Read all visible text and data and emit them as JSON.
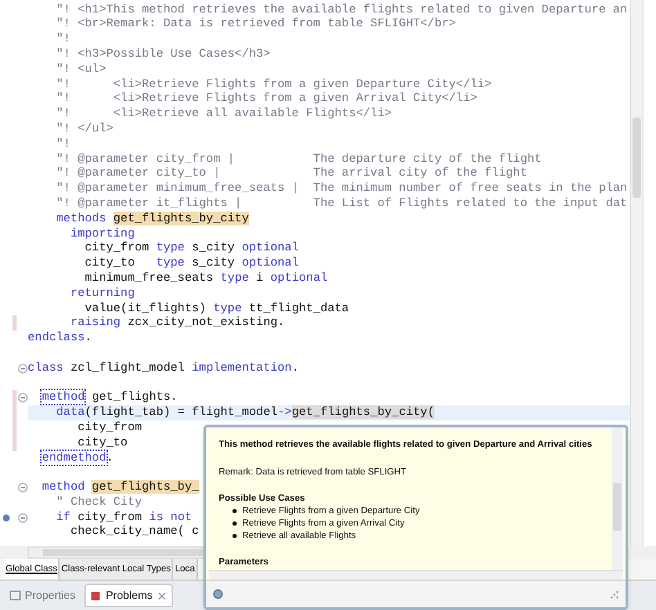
{
  "editor": {
    "lines": [
      {
        "segments": [
          {
            "kind": "comment",
            "text": "    \"! <h1>This method retrieves the available flights related to given Departure an"
          }
        ],
        "fold": false,
        "changed": false,
        "current": false,
        "bookmark": false
      },
      {
        "segments": [
          {
            "kind": "comment",
            "text": "    \"! <br>Remark: Data is retrieved from table SFLIGHT</br>"
          }
        ],
        "fold": false,
        "changed": false,
        "current": false,
        "bookmark": false
      },
      {
        "segments": [
          {
            "kind": "comment",
            "text": "    \"!"
          }
        ],
        "fold": false,
        "changed": false,
        "current": false,
        "bookmark": false
      },
      {
        "segments": [
          {
            "kind": "comment",
            "text": "    \"! <h3>Possible Use Cases</h3>"
          }
        ],
        "fold": false,
        "changed": false,
        "current": false,
        "bookmark": false
      },
      {
        "segments": [
          {
            "kind": "comment",
            "text": "    \"! <ul>"
          }
        ],
        "fold": false,
        "changed": false,
        "current": false,
        "bookmark": false
      },
      {
        "segments": [
          {
            "kind": "comment",
            "text": "    \"!      <li>Retrieve Flights from a given Departure City</li>"
          }
        ],
        "fold": false,
        "changed": false,
        "current": false,
        "bookmark": false
      },
      {
        "segments": [
          {
            "kind": "comment",
            "text": "    \"!      <li>Retrieve Flights from a given Arrival City</li>"
          }
        ],
        "fold": false,
        "changed": false,
        "current": false,
        "bookmark": false
      },
      {
        "segments": [
          {
            "kind": "comment",
            "text": "    \"!      <li>Retrieve all available Flights</li>"
          }
        ],
        "fold": false,
        "changed": false,
        "current": false,
        "bookmark": false
      },
      {
        "segments": [
          {
            "kind": "comment",
            "text": "    \"! </ul>"
          }
        ],
        "fold": false,
        "changed": false,
        "current": false,
        "bookmark": false
      },
      {
        "segments": [
          {
            "kind": "comment",
            "text": "    \"!"
          }
        ],
        "fold": false,
        "changed": false,
        "current": false,
        "bookmark": false
      },
      {
        "segments": [
          {
            "kind": "comment",
            "text": "    \"! @parameter city_from |           The departure city of the flight"
          }
        ],
        "fold": false,
        "changed": false,
        "current": false,
        "bookmark": false
      },
      {
        "segments": [
          {
            "kind": "comment",
            "text": "    \"! @parameter city_to |             The arrival city of the flight"
          }
        ],
        "fold": false,
        "changed": false,
        "current": false,
        "bookmark": false
      },
      {
        "segments": [
          {
            "kind": "comment",
            "text": "    \"! @parameter minimum_free_seats |  The minimum number of free seats in the plan"
          }
        ],
        "fold": false,
        "changed": false,
        "current": false,
        "bookmark": false
      },
      {
        "segments": [
          {
            "kind": "comment",
            "text": "    \"! @parameter it_flights |          The List of Flights related to the input dat"
          }
        ],
        "fold": false,
        "changed": false,
        "current": false,
        "bookmark": false
      },
      {
        "segments": [
          {
            "kind": "keyword",
            "text": "    methods "
          },
          {
            "kind": "highlight",
            "text": "get_flights_by_city"
          }
        ],
        "fold": false,
        "changed": false,
        "current": false,
        "bookmark": false
      },
      {
        "segments": [
          {
            "kind": "keyword",
            "text": "      importing"
          }
        ],
        "fold": false,
        "changed": false,
        "current": false,
        "bookmark": false
      },
      {
        "segments": [
          {
            "kind": "text",
            "text": "        city_from "
          },
          {
            "kind": "keyword",
            "text": "type"
          },
          {
            "kind": "text",
            "text": " s_city "
          },
          {
            "kind": "keyword",
            "text": "optional"
          }
        ],
        "fold": false,
        "changed": false,
        "current": false,
        "bookmark": false
      },
      {
        "segments": [
          {
            "kind": "text",
            "text": "        city_to   "
          },
          {
            "kind": "keyword",
            "text": "type"
          },
          {
            "kind": "text",
            "text": " s_city "
          },
          {
            "kind": "keyword",
            "text": "optional"
          }
        ],
        "fold": false,
        "changed": false,
        "current": false,
        "bookmark": false
      },
      {
        "segments": [
          {
            "kind": "text",
            "text": "        minimum_free_seats "
          },
          {
            "kind": "keyword",
            "text": "type"
          },
          {
            "kind": "text",
            "text": " i "
          },
          {
            "kind": "keyword",
            "text": "optional"
          }
        ],
        "fold": false,
        "changed": false,
        "current": false,
        "bookmark": false
      },
      {
        "segments": [
          {
            "kind": "keyword",
            "text": "      returning"
          }
        ],
        "fold": false,
        "changed": false,
        "current": false,
        "bookmark": false
      },
      {
        "segments": [
          {
            "kind": "text",
            "text": "        value(it_flights) "
          },
          {
            "kind": "keyword",
            "text": "type"
          },
          {
            "kind": "text",
            "text": " tt_flight_data"
          }
        ],
        "fold": false,
        "changed": false,
        "current": false,
        "bookmark": false
      },
      {
        "segments": [
          {
            "kind": "keyword",
            "text": "      raising"
          },
          {
            "kind": "text",
            "text": " zcx_city_not_existing."
          }
        ],
        "fold": false,
        "changed": true,
        "current": false,
        "bookmark": false
      },
      {
        "segments": [
          {
            "kind": "keyword",
            "text": "endclass"
          },
          {
            "kind": "text",
            "text": "."
          }
        ],
        "fold": false,
        "changed": false,
        "current": false,
        "bookmark": false
      },
      {
        "fold": false,
        "changed": false,
        "current": false,
        "bookmark": false
      },
      {
        "segments": [
          {
            "kind": "keyword",
            "text": "class"
          },
          {
            "kind": "text",
            "text": " zcl_flight_model "
          },
          {
            "kind": "keyword",
            "text": "implementation"
          },
          {
            "kind": "text",
            "text": "."
          }
        ],
        "fold": true,
        "changed": false,
        "current": false,
        "bookmark": false
      },
      {
        "fold": false,
        "changed": false,
        "current": false,
        "bookmark": false
      },
      {
        "segments": [
          {
            "kind": "matched",
            "text": "  method"
          },
          {
            "kind": "text",
            "text": " get_flights."
          }
        ],
        "fold": true,
        "changed": true,
        "current": false,
        "bookmark": false
      },
      {
        "segments": [
          {
            "kind": "keyword",
            "text": "    data"
          },
          {
            "kind": "text",
            "text": "(flight_tab) = flight_model"
          },
          {
            "kind": "keyword",
            "text": "->"
          },
          {
            "kind": "occurrence",
            "text": "get_flights_by_city("
          }
        ],
        "fold": false,
        "changed": true,
        "current": true,
        "bookmark": false
      },
      {
        "segments": [
          {
            "kind": "text",
            "text": "       city_from"
          }
        ],
        "fold": false,
        "changed": true,
        "current": false,
        "bookmark": false
      },
      {
        "segments": [
          {
            "kind": "text",
            "text": "       city_to"
          }
        ],
        "fold": false,
        "changed": true,
        "current": false,
        "bookmark": false
      },
      {
        "segments": [
          {
            "kind": "matched",
            "text": "  endmethod"
          },
          {
            "kind": "text",
            "text": "."
          }
        ],
        "fold": false,
        "changed": false,
        "current": false,
        "bookmark": false
      },
      {
        "fold": false,
        "changed": false,
        "current": false,
        "bookmark": false
      },
      {
        "segments": [
          {
            "kind": "keyword",
            "text": "  method "
          },
          {
            "kind": "highlight",
            "text": "get_flights_by_"
          }
        ],
        "fold": true,
        "changed": false,
        "current": false,
        "bookmark": false
      },
      {
        "segments": [
          {
            "kind": "comment",
            "text": "    \" Check City"
          }
        ],
        "fold": false,
        "changed": false,
        "current": false,
        "bookmark": false
      },
      {
        "segments": [
          {
            "kind": "keyword",
            "text": "    if"
          },
          {
            "kind": "text",
            "text": " city_from "
          },
          {
            "kind": "keyword",
            "text": "is not"
          }
        ],
        "fold": true,
        "changed": false,
        "current": false,
        "bookmark": true
      },
      {
        "segments": [
          {
            "kind": "text",
            "text": "      check_city_name( c"
          }
        ],
        "fold": false,
        "changed": false,
        "current": false,
        "bookmark": false
      }
    ]
  },
  "editor_tabs": [
    {
      "label": "Global Class",
      "selected": true
    },
    {
      "label": "Class-relevant Local Types",
      "selected": false
    },
    {
      "label": "Loca",
      "selected": false
    }
  ],
  "views": [
    {
      "label": "Properties",
      "selected": false,
      "kind": "properties"
    },
    {
      "label": "Problems",
      "selected": true,
      "kind": "problems"
    }
  ],
  "tooltip": {
    "title": "This method retrieves the available flights related to given Departure and Arrival cities",
    "remark": "Remark: Data is retrieved from table SFLIGHT",
    "heading": "Possible Use Cases",
    "items": [
      "Retrieve Flights from a given Departure City",
      "Retrieve Flights from a given Arrival City",
      "Retrieve all available Flights"
    ],
    "section": "Parameters"
  }
}
